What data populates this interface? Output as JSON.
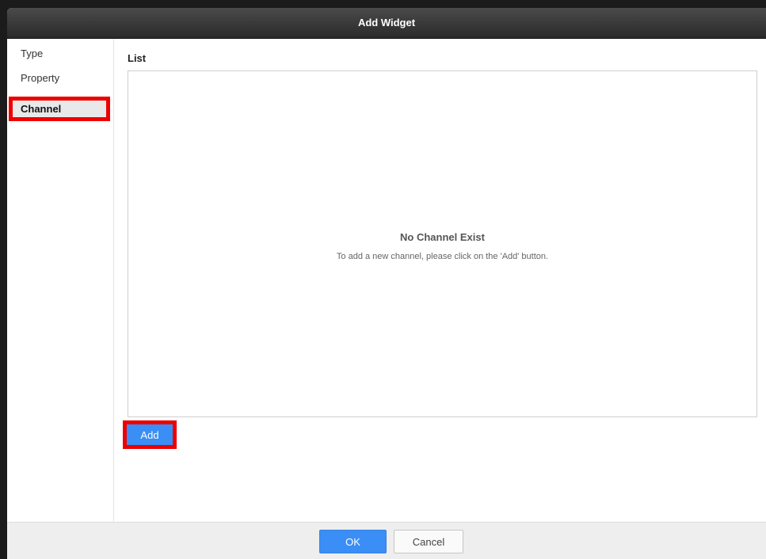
{
  "dialog": {
    "title": "Add Widget"
  },
  "sidebar": {
    "items": [
      {
        "label": "Type"
      },
      {
        "label": "Property"
      },
      {
        "label": "Channel"
      }
    ],
    "active": "Channel"
  },
  "main": {
    "list_label": "List",
    "empty_title": "No Channel Exist",
    "empty_description": "To add a new channel, please click on the 'Add' button.",
    "add_label": "Add"
  },
  "footer": {
    "ok_label": "OK",
    "cancel_label": "Cancel"
  },
  "colors": {
    "accent": "#3a8ef5",
    "highlight": "#ee0000",
    "titlebar": "#3a3a3a"
  }
}
